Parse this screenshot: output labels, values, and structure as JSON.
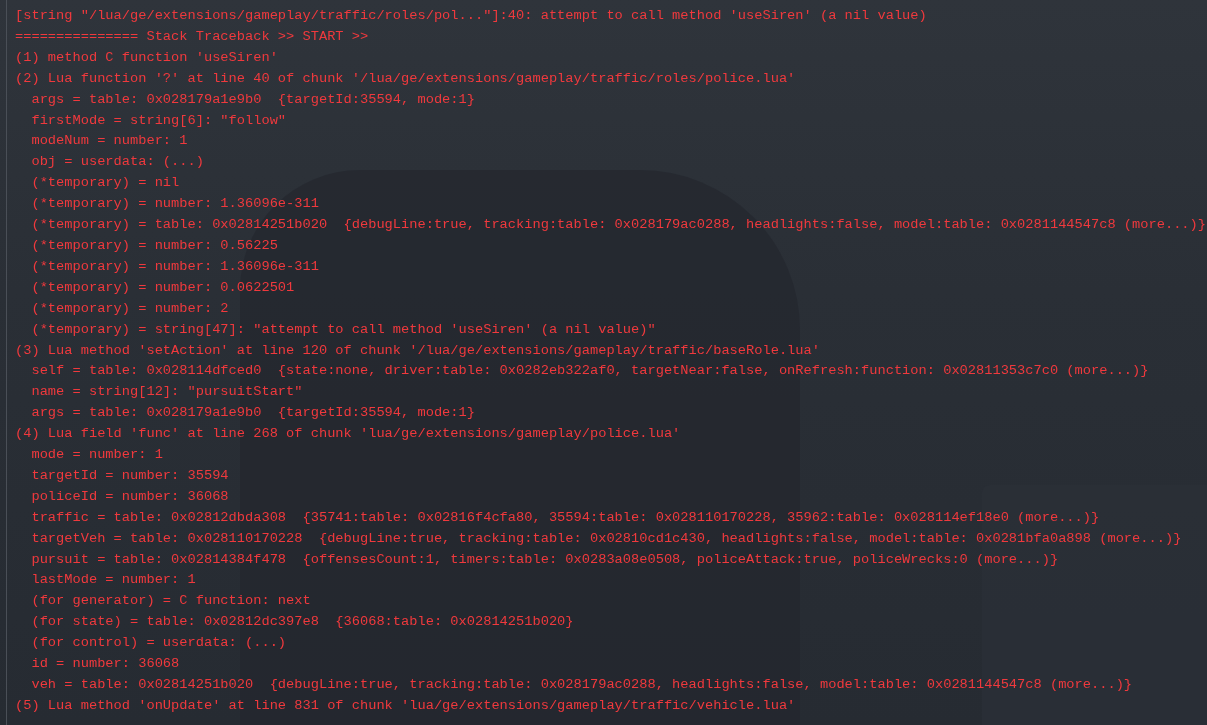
{
  "console": {
    "lines": [
      "[string \"/lua/ge/extensions/gameplay/traffic/roles/pol...\"]:40: attempt to call method 'useSiren' (a nil value)",
      "=============== Stack Traceback >> START >>",
      "(1) method C function 'useSiren'",
      "(2) Lua function '?' at line 40 of chunk '/lua/ge/extensions/gameplay/traffic/roles/police.lua'",
      "  args = table: 0x028179a1e9b0  {targetId:35594, mode:1}",
      "  firstMode = string[6]: \"follow\"",
      "  modeNum = number: 1",
      "  obj = userdata: (...)",
      "  (*temporary) = nil",
      "  (*temporary) = number: 1.36096e-311",
      "  (*temporary) = table: 0x02814251b020  {debugLine:true, tracking:table: 0x028179ac0288, headlights:false, model:table: 0x0281144547c8 (more...)}",
      "  (*temporary) = number: 0.56225",
      "  (*temporary) = number: 1.36096e-311",
      "  (*temporary) = number: 0.0622501",
      "  (*temporary) = number: 2",
      "  (*temporary) = string[47]: \"attempt to call method 'useSiren' (a nil value)\"",
      "(3) Lua method 'setAction' at line 120 of chunk '/lua/ge/extensions/gameplay/traffic/baseRole.lua'",
      "  self = table: 0x028114dfced0  {state:none, driver:table: 0x0282eb322af0, targetNear:false, onRefresh:function: 0x02811353c7c0 (more...)}",
      "  name = string[12]: \"pursuitStart\"",
      "  args = table: 0x028179a1e9b0  {targetId:35594, mode:1}",
      "(4) Lua field 'func' at line 268 of chunk 'lua/ge/extensions/gameplay/police.lua'",
      "  mode = number: 1",
      "  targetId = number: 35594",
      "  policeId = number: 36068",
      "  traffic = table: 0x02812dbda308  {35741:table: 0x02816f4cfa80, 35594:table: 0x028110170228, 35962:table: 0x028114ef18e0 (more...)}",
      "  targetVeh = table: 0x028110170228  {debugLine:true, tracking:table: 0x02810cd1c430, headlights:false, model:table: 0x0281bfa0a898 (more...)}",
      "  pursuit = table: 0x02814384f478  {offensesCount:1, timers:table: 0x0283a08e0508, policeAttack:true, policeWrecks:0 (more...)}",
      "  lastMode = number: 1",
      "  (for generator) = C function: next",
      "  (for state) = table: 0x02812dc397e8  {36068:table: 0x02814251b020}",
      "  (for control) = userdata: (...)",
      "  id = number: 36068",
      "  veh = table: 0x02814251b020  {debugLine:true, tracking:table: 0x028179ac0288, headlights:false, model:table: 0x0281144547c8 (more...)}",
      "(5) Lua method 'onUpdate' at line 831 of chunk 'lua/ge/extensions/gameplay/traffic/vehicle.lua'"
    ]
  }
}
